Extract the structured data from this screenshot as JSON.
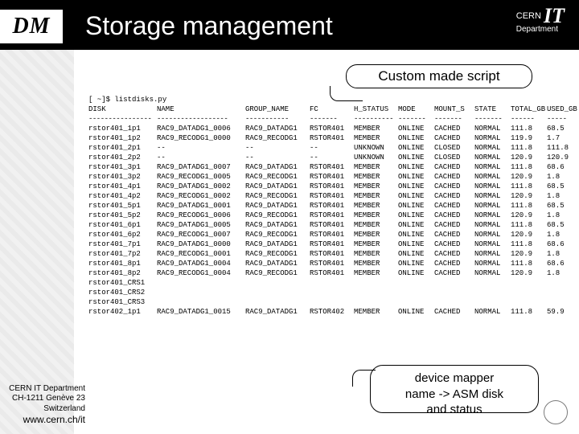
{
  "header": {
    "dm": "DM",
    "title": "Storage management",
    "cern_top": "CERN",
    "cern_it": "IT",
    "cern_dept": "Department"
  },
  "callouts": {
    "top": "Custom made script",
    "bottom_l1": "device mapper",
    "bottom_l2": "name -> ASM disk",
    "bottom_l3": "and status"
  },
  "prompt": "[ ~]$ listdisks.py",
  "columns": [
    "DISK",
    "NAME",
    "GROUP_NAME",
    "FC",
    "H_STATUS",
    "MODE",
    "MOUNT_S",
    "STATE",
    "TOTAL_GB",
    "USED_GB"
  ],
  "dashes": [
    "----------------",
    "------------------",
    "-----------",
    "-------",
    "----------",
    "-------",
    "-------",
    "-------",
    "------",
    "-----"
  ],
  "rows": [
    [
      "rstor401_1p1",
      "RAC9_DATADG1_0006",
      "RAC9_DATADG1",
      "RSTOR401",
      "MEMBER",
      "ONLINE",
      "CACHED",
      "NORMAL",
      "111.8",
      "68.5"
    ],
    [
      "rstor401_1p2",
      "RAC9_RECODG1_0000",
      "RAC9_RECODG1",
      "RSTOR401",
      "MEMBER",
      "ONLINE",
      "CACHED",
      "NORMAL",
      "119.9",
      "1.7"
    ],
    [
      "rstor401_2p1",
      "--",
      "--",
      "--",
      "UNKNOWN",
      "ONLINE",
      "CLOSED",
      "NORMAL",
      "111.8",
      "111.8"
    ],
    [
      "rstor401_2p2",
      "--",
      "--",
      "--",
      "UNKNOWN",
      "ONLINE",
      "CLOSED",
      "NORMAL",
      "120.9",
      "120.9"
    ],
    [
      "rstor401_3p1",
      "RAC9_DATADG1_0007",
      "RAC9_DATADG1",
      "RSTOR401",
      "MEMBER",
      "ONLINE",
      "CACHED",
      "NORMAL",
      "111.8",
      "68.6"
    ],
    [
      "rstor401_3p2",
      "RAC9_RECODG1_0005",
      "RAC9_RECODG1",
      "RSTOR401",
      "MEMBER",
      "ONLINE",
      "CACHED",
      "NORMAL",
      "120.9",
      "1.8"
    ],
    [
      "rstor401_4p1",
      "RAC9_DATADG1_0002",
      "RAC9_DATADG1",
      "RSTOR401",
      "MEMBER",
      "ONLINE",
      "CACHED",
      "NORMAL",
      "111.8",
      "68.5"
    ],
    [
      "rstor401_4p2",
      "RAC9_RECODG1_0002",
      "RAC9_RECODG1",
      "RSTOR401",
      "MEMBER",
      "ONLINE",
      "CACHED",
      "NORMAL",
      "120.9",
      "1.8"
    ],
    [
      "rstor401_5p1",
      "RAC9_DATADG1_0001",
      "RAC9_DATADG1",
      "RSTOR401",
      "MEMBER",
      "ONLINE",
      "CACHED",
      "NORMAL",
      "111.8",
      "68.5"
    ],
    [
      "rstor401_5p2",
      "RAC9_RECODG1_0006",
      "RAC9_RECODG1",
      "RSTOR401",
      "MEMBER",
      "ONLINE",
      "CACHED",
      "NORMAL",
      "120.9",
      "1.8"
    ],
    [
      "rstor401_6p1",
      "RAC9_DATADG1_0005",
      "RAC9_DATADG1",
      "RSTOR401",
      "MEMBER",
      "ONLINE",
      "CACHED",
      "NORMAL",
      "111.8",
      "68.5"
    ],
    [
      "rstor401_6p2",
      "RAC9_RECODG1_0007",
      "RAC9_RECODG1",
      "RSTOR401",
      "MEMBER",
      "ONLINE",
      "CACHED",
      "NORMAL",
      "120.9",
      "1.8"
    ],
    [
      "rstor401_7p1",
      "RAC9_DATADG1_0000",
      "RAC9_DATADG1",
      "RSTOR401",
      "MEMBER",
      "ONLINE",
      "CACHED",
      "NORMAL",
      "111.8",
      "68.6"
    ],
    [
      "rstor401_7p2",
      "RAC9_RECODG1_0001",
      "RAC9_RECODG1",
      "RSTOR401",
      "MEMBER",
      "ONLINE",
      "CACHED",
      "NORMAL",
      "120.9",
      "1.8"
    ],
    [
      "rstor401_8p1",
      "RAC9_DATADG1_0004",
      "RAC9_DATADG1",
      "RSTOR401",
      "MEMBER",
      "ONLINE",
      "CACHED",
      "NORMAL",
      "111.8",
      "68.6"
    ],
    [
      "rstor401_8p2",
      "RAC9_RECODG1_0004",
      "RAC9_RECODG1",
      "RSTOR401",
      "MEMBER",
      "ONLINE",
      "CACHED",
      "NORMAL",
      "120.9",
      "1.8"
    ],
    [
      "rstor401_CRS1",
      "",
      "",
      "",
      "",
      "",
      "",
      "",
      "",
      ""
    ],
    [
      "rstor401_CRS2",
      "",
      "",
      "",
      "",
      "",
      "",
      "",
      "",
      ""
    ],
    [
      "rstor401_CRS3",
      "",
      "",
      "",
      "",
      "",
      "",
      "",
      "",
      ""
    ],
    [
      "rstor402_1p1",
      "RAC9_DATADG1_0015",
      "RAC9_DATADG1",
      "RSTOR402",
      "MEMBER",
      "ONLINE",
      "CACHED",
      "NORMAL",
      "111.8",
      "59.9"
    ]
  ],
  "footer": {
    "l1": "CERN IT Department",
    "l2": "CH-1211 Genève 23",
    "l3": "Switzerland",
    "url": "www.cern.ch/it"
  }
}
